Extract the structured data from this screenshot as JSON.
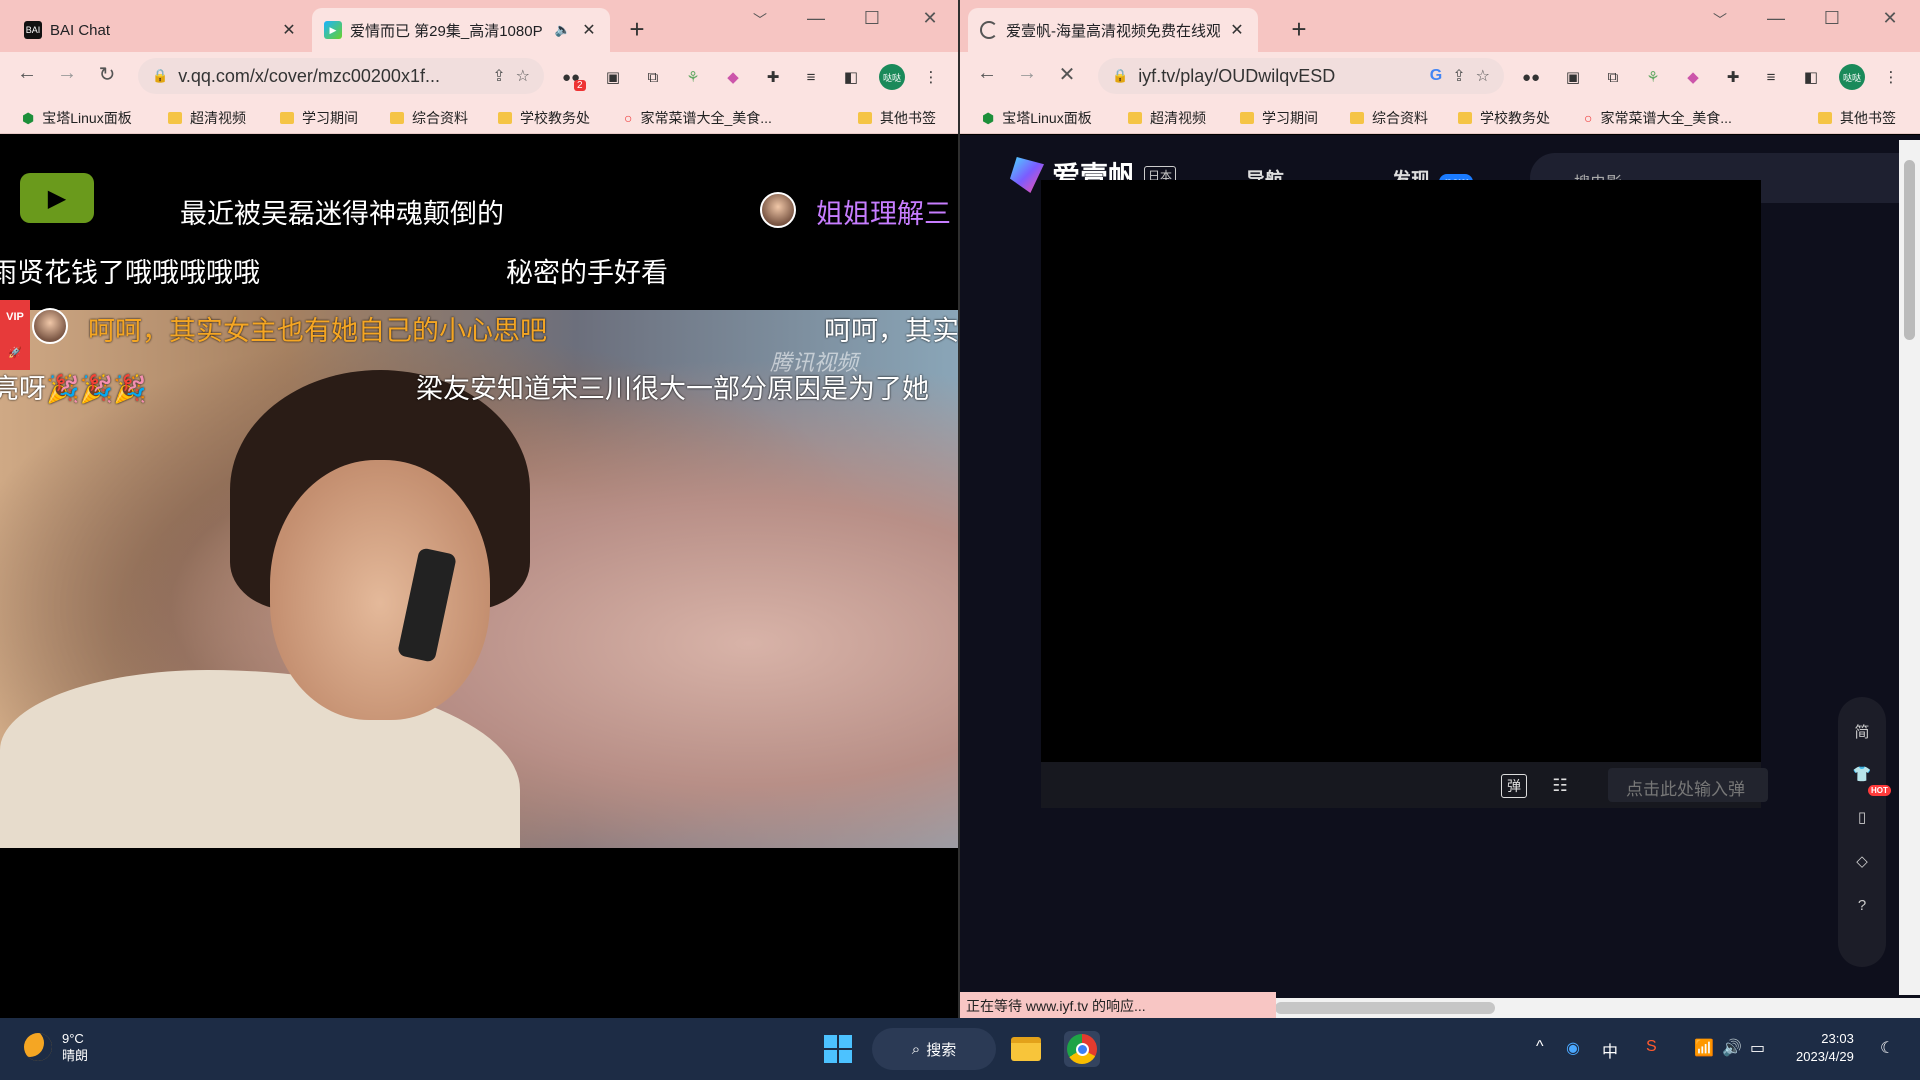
{
  "left_window": {
    "tabs": [
      {
        "title": "BAI Chat",
        "favicon": "bai-favicon"
      },
      {
        "title": "爱情而已 第29集_高清1080P",
        "favicon": "tencent-video-favicon",
        "audio": true
      }
    ],
    "url": "v.qq.com/x/cover/mzc00200x1f...",
    "ext_badge": "2",
    "profile": "哒哒",
    "bookmarks": [
      "宝塔Linux面板",
      "超清视频",
      "学习期间",
      "综合资料",
      "学校教务处",
      "家常菜谱大全_美食...",
      "其他书签"
    ],
    "danmaku": [
      "最近被吴磊迷得神魂颠倒的",
      "姐姐理解三",
      "雨贤花钱了哦哦哦哦哦",
      "秘密的手好看",
      "呵呵，其实女主也有她自己的小心思吧",
      "呵呵，其实",
      "亮呀🎉🎉🎉",
      "梁友安知道宋三川很大一部分原因是为了她"
    ],
    "vip_label": "VIP",
    "watermark": "腾讯视频"
  },
  "right_window": {
    "tabs": [
      {
        "title": "爱壹帆-海量高清视频免费在线观",
        "loading": true
      }
    ],
    "url": "iyf.tv/play/OUDwilqvESD",
    "profile": "哒哒",
    "bookmarks": [
      "宝塔Linux面板",
      "超清视频",
      "学习期间",
      "综合资料",
      "学校教务处",
      "家常菜谱大全_美食...",
      "其他书签"
    ],
    "site": {
      "name": "爱壹帆",
      "region_tag": "日本",
      "nav_label": "导航",
      "discover_label": "发现",
      "new_badge": "new",
      "search_placeholder": "搜电影",
      "danmaku_toggle": "弹",
      "danmaku_input_placeholder": "点击此处输入弹",
      "side_simplified": "简",
      "hot_badge": "HOT"
    },
    "status_text": "正在等待 www.iyf.tv 的响应..."
  },
  "taskbar": {
    "temperature": "9°C",
    "weather": "晴朗",
    "search_label": "搜索",
    "ime": "中",
    "time": "23:03",
    "date": "2023/4/29"
  },
  "colors": {
    "tab_bar": "#f6c5c2",
    "toolbar": "#fbe3e1",
    "taskbar": "#1d2c45",
    "danmaku_orange": "#f5a623",
    "danmaku_purple": "#c77dff"
  }
}
